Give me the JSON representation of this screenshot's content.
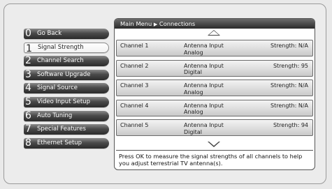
{
  "breadcrumb": {
    "root": "Main Menu",
    "separator": "▶",
    "current": "Connections"
  },
  "menu": [
    {
      "num": "0",
      "label": "Go Back",
      "selected": false
    },
    {
      "num": "1",
      "label": "Signal Strength",
      "selected": true
    },
    {
      "num": "2",
      "label": "Channel Search",
      "selected": false
    },
    {
      "num": "3",
      "label": "Software Upgrade",
      "selected": false
    },
    {
      "num": "4",
      "label": "Signal Source",
      "selected": false
    },
    {
      "num": "5",
      "label": "Video Input Setup",
      "selected": false
    },
    {
      "num": "6",
      "label": "Auto Tuning",
      "selected": false
    },
    {
      "num": "7",
      "label": "Special Features",
      "selected": false
    },
    {
      "num": "8",
      "label": "Ethernet Setup",
      "selected": false
    }
  ],
  "channels": [
    {
      "channel": "Channel 1",
      "input": "Antenna Input",
      "type": "Analog",
      "strength": "Strength: N/A"
    },
    {
      "channel": "Channel 2",
      "input": "Antenna Input",
      "type": "Digital",
      "strength": "Strength: 95"
    },
    {
      "channel": "Channel 3",
      "input": "Antenna Input",
      "type": "Analog",
      "strength": "Strength: N/A"
    },
    {
      "channel": "Channel 4",
      "input": "Antenna Input",
      "type": "Analog",
      "strength": "Strength: N/A"
    },
    {
      "channel": "Channel 5",
      "input": "Antenna Input",
      "type": "Digital",
      "strength": "Strength: 94"
    }
  ],
  "help_text": "Press OK to measure the signal strengths of all channels to help you adjust terrestrial TV antenna(s).",
  "colors": {
    "menu_item_dark": "#2b2b2b",
    "menu_item_selected": "#ffffff",
    "panel_header": "#2a2a2a"
  }
}
